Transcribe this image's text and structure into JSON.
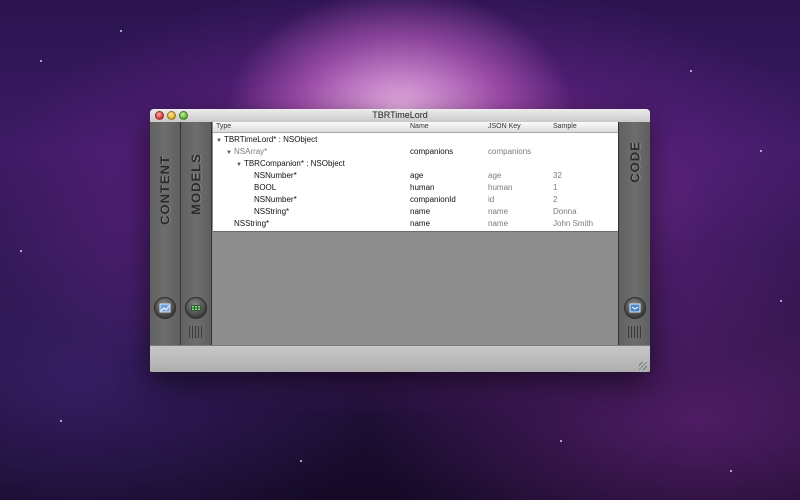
{
  "window": {
    "title": "TBRTimeLord"
  },
  "side_panels": {
    "content_label": "CONTENT",
    "models_label": "MODELS",
    "code_label": "CODE"
  },
  "table": {
    "headers": [
      "Type",
      "Name",
      "JSON Key",
      "Sample"
    ],
    "rows": [
      {
        "type": "TBRTimeLord* : NSObject",
        "name": "",
        "json_key": "",
        "sample": ""
      },
      {
        "type": "NSArray*",
        "name": "companions",
        "json_key": "companions",
        "sample": ""
      },
      {
        "type": "TBRCompanion* : NSObject",
        "name": "",
        "json_key": "",
        "sample": ""
      },
      {
        "type": "NSNumber*",
        "name": "age",
        "json_key": "age",
        "sample": "32"
      },
      {
        "type": "BOOL",
        "name": "human",
        "json_key": "human",
        "sample": "1"
      },
      {
        "type": "NSNumber*",
        "name": "companionId",
        "json_key": "id",
        "sample": "2"
      },
      {
        "type": "NSString*",
        "name": "name",
        "json_key": "name",
        "sample": "Donna"
      },
      {
        "type": "NSString*",
        "name": "name",
        "json_key": "name",
        "sample": "John Smith"
      }
    ]
  },
  "icons": {
    "disclosure": "disclosure-triangle-icon",
    "content_button": "image-edit-icon",
    "models_button": "grid-icon",
    "code_button": "export-code-icon"
  }
}
